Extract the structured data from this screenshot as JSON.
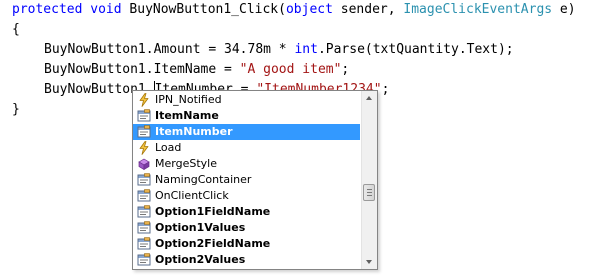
{
  "editor": {
    "line1": {
      "kw_protected": "protected",
      "kw_void": "void",
      "method": "BuyNowButton1_Click(",
      "kw_object": "object",
      "param1": " sender, ",
      "type_args": "ImageClickEventArgs",
      "param2": " e)"
    },
    "line2": {
      "brace": "{"
    },
    "line3": {
      "left": "BuyNowButton1.Amount = 34.78m * ",
      "kw_int": "int",
      "right": ".Parse(txtQuantity.Text);"
    },
    "line4": {
      "left": "BuyNowButton1.ItemName = ",
      "str": "\"A good item\"",
      "end": ";"
    },
    "line5": {
      "left": "BuyNowButton1.",
      "ident": "ItemNumber",
      "mid": " = ",
      "str": "\"ItemNumber1234\"",
      "end": ";"
    },
    "line6": {
      "brace": "}"
    }
  },
  "completion": {
    "items": [
      {
        "label": "IPN_Notified",
        "icon": "event-icon",
        "bold": false,
        "selected": false
      },
      {
        "label": "ItemName",
        "icon": "property-icon",
        "bold": true,
        "selected": false
      },
      {
        "label": "ItemNumber",
        "icon": "property-icon",
        "bold": true,
        "selected": true
      },
      {
        "label": "Load",
        "icon": "event-icon",
        "bold": false,
        "selected": false
      },
      {
        "label": "MergeStyle",
        "icon": "method-icon",
        "bold": false,
        "selected": false
      },
      {
        "label": "NamingContainer",
        "icon": "property-icon",
        "bold": false,
        "selected": false
      },
      {
        "label": "OnClientClick",
        "icon": "property-icon",
        "bold": false,
        "selected": false
      },
      {
        "label": "Option1FieldName",
        "icon": "property-icon",
        "bold": true,
        "selected": false
      },
      {
        "label": "Option1Values",
        "icon": "property-icon",
        "bold": true,
        "selected": false
      },
      {
        "label": "Option2FieldName",
        "icon": "property-icon",
        "bold": true,
        "selected": false
      },
      {
        "label": "Option2Values",
        "icon": "property-icon",
        "bold": true,
        "selected": false
      }
    ],
    "scroll_position": 0.55
  },
  "colors": {
    "keyword": "#0000ff",
    "type": "#2b91af",
    "string": "#a31515",
    "selection": "#3399ff"
  }
}
